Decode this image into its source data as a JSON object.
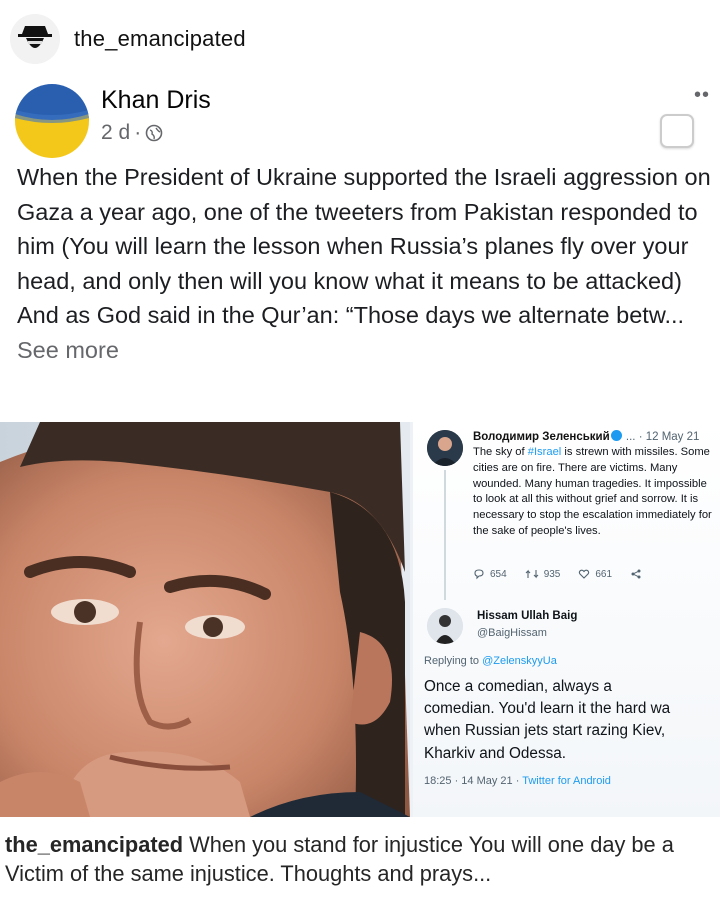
{
  "header": {
    "username": "the_emancipated"
  },
  "post": {
    "author": "Khan Dris",
    "time": "2 d",
    "more_icon": "more-dots-icon",
    "paragraph1": "When the President of Ukraine supported the Israeli aggression on Gaza a year ago, one of the tweeters from Pakistan responded to him (You will learn the lesson when Russia’s planes fly over your head, and only then will you know what it means to be attacked)",
    "paragraph2": "And as God said in the Qur’an: “Those days we alternate betw...",
    "see_more": "See more"
  },
  "tweet1": {
    "name": "Володимир Зеленський",
    "date": "· 12 May 21",
    "text_before": "The sky of ",
    "hashtag": "#Israel",
    "text_after": " is strewn with missiles. Some cities are on fire. There are victims. Many wounded. Many human tragedies. It impossible to look at all this without grief and sorrow. It is necessary to stop the escalation immediately for the sake of people's lives.",
    "replies": "654",
    "retweets": "935",
    "likes": "661"
  },
  "tweet2": {
    "name": "Hissam Ullah Baig",
    "handle": "@BaigHissam",
    "replying_label": "Replying to ",
    "replying_to": "@ZelenskyyUa",
    "line1": "Once a comedian, always a",
    "line2": "comedian. You'd learn it the hard wa",
    "line3": "when Russian jets start razing Kiev,",
    "line4": "Kharkiv and Odessa.",
    "timestamp": "18:25 · 14 May 21 · ",
    "client": "Twitter for Android"
  },
  "caption": {
    "username": "the_emancipated",
    "text": " When you stand for injustice You will one day be a Victim of the same injustice. Thoughts and prays..."
  },
  "colors": {
    "link_blue": "#1d9bf0",
    "secondary_text": "#65676b",
    "flag_blue": "#2a5fb0",
    "flag_yellow": "#f3c81a"
  }
}
